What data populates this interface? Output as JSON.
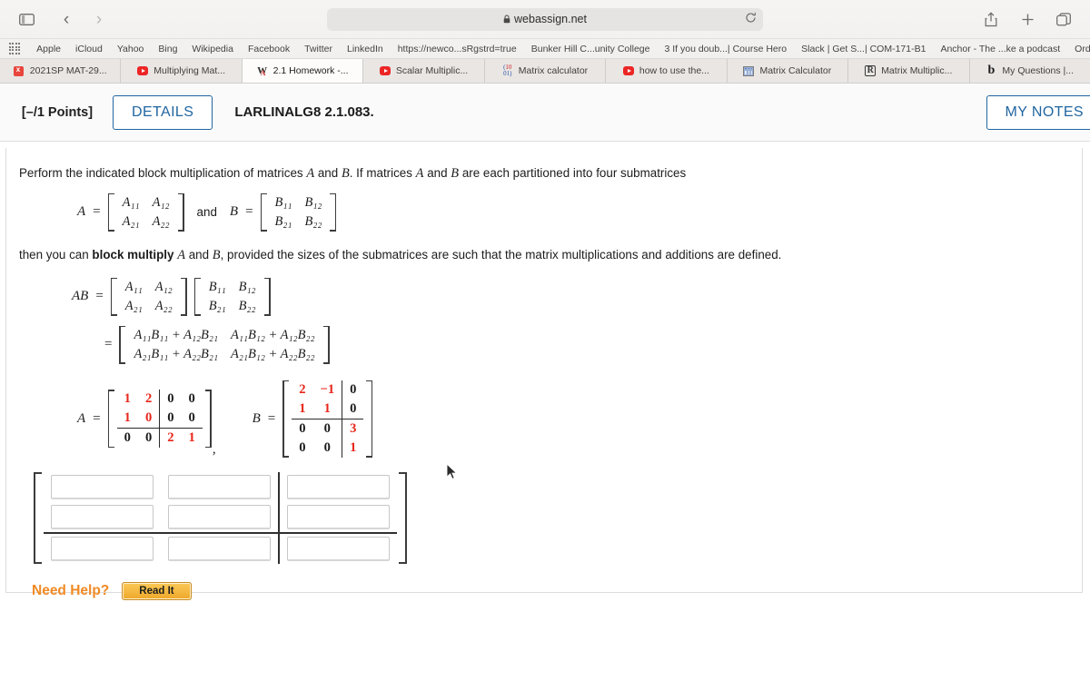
{
  "browser": {
    "url": "webassign.net",
    "lock_icon": "lock-icon",
    "sidebar_icon": "sidebar-icon",
    "back_icon": "chevron-left-icon",
    "forward_icon": "chevron-right-icon",
    "extension_icons": [
      "honey-extension-icon",
      "shield-extension-icon"
    ],
    "reload_icon": "reload-icon",
    "share_icon": "share-icon",
    "new_tab_icon": "plus-icon",
    "tab_overview_icon": "tab-overview-icon",
    "bookmarks": [
      "Apple",
      "iCloud",
      "Yahoo",
      "Bing",
      "Wikipedia",
      "Facebook",
      "Twitter",
      "LinkedIn",
      "https://newco...sRgstrd=true",
      "Bunker Hill C...unity College",
      "3 If you doub...| Course Hero",
      "Slack | Get S...| COM-171-B1",
      "Anchor - The ...ke a podcast",
      "Order received"
    ],
    "bookmarks_overflow": "»",
    "tabs": [
      {
        "label": "2021SP MAT-29...",
        "icon": "excel-icon",
        "active": false
      },
      {
        "label": "Multiplying Mat...",
        "icon": "youtube-icon",
        "active": false
      },
      {
        "label": "2.1 Homework -...",
        "icon": "webassign-icon",
        "active": true
      },
      {
        "label": "Scalar Multiplic...",
        "icon": "youtube-icon",
        "active": false
      },
      {
        "label": "Matrix calculator",
        "icon": "matrix-calc-icon",
        "active": false
      },
      {
        "label": "how to use the...",
        "icon": "youtube-icon",
        "active": false
      },
      {
        "label": "Matrix Calculator",
        "icon": "spreadsheet-icon",
        "active": false
      },
      {
        "label": "Matrix Multiplic...",
        "icon": "rstudio-icon",
        "active": false
      },
      {
        "label": "My Questions |...",
        "icon": "brainly-icon",
        "active": false
      }
    ]
  },
  "question": {
    "points": "[–/1 Points]",
    "details_label": "DETAILS",
    "title": "LARLINALG8 2.1.083.",
    "my_notes_label": "MY NOTES",
    "intro_part1": "Perform the indicated block multiplication of matrices",
    "intro_a": "A",
    "intro_and": "and",
    "intro_b": "B",
    "intro_part2": ". If matrices",
    "intro_part3": "are each partitioned into four submatrices",
    "then_text_1": "then you can",
    "then_bold": "block multiply",
    "then_text_2": "and",
    "then_text_3": ", provided the sizes of the submatrices are such that the matrix multiplications and additions are defined.",
    "label_A": "A",
    "label_B": "B",
    "label_AB": "AB",
    "label_eq": "=",
    "label_and": "and",
    "comma": ",",
    "symbolic_A": [
      [
        "A₁₁",
        "A₁₂"
      ],
      [
        "A₂₁",
        "A₂₂"
      ]
    ],
    "symbolic_B": [
      [
        "B₁₁",
        "B₁₂"
      ],
      [
        "B₂₁",
        "B₂₂"
      ]
    ],
    "product_expansion": [
      [
        "A₁₁B₁₁ + A₁₂B₂₁",
        "A₁₁B₁₂ + A₁₂B₂₂"
      ],
      [
        "A₂₁B₁₁ + A₂₂B₂₁",
        "A₂₁B₁₂ + A₂₂B₂₂"
      ]
    ],
    "need_help_label": "Need Help?",
    "read_it_label": "Read It"
  },
  "matrix_A": {
    "rows": 3,
    "cols": 4,
    "partition_after_row": 2,
    "partition_after_col": 2,
    "highlight_color": "#e8261c",
    "cells": [
      [
        {
          "v": "1",
          "red": true
        },
        {
          "v": "2",
          "red": true
        },
        {
          "v": "0",
          "red": false
        },
        {
          "v": "0",
          "red": false
        }
      ],
      [
        {
          "v": "1",
          "red": true
        },
        {
          "v": "0",
          "red": true
        },
        {
          "v": "0",
          "red": false
        },
        {
          "v": "0",
          "red": false
        }
      ],
      [
        {
          "v": "0",
          "red": false
        },
        {
          "v": "0",
          "red": false
        },
        {
          "v": "2",
          "red": true
        },
        {
          "v": "1",
          "red": true
        }
      ]
    ]
  },
  "matrix_B": {
    "rows": 4,
    "cols": 3,
    "partition_after_row": 2,
    "partition_after_col": 2,
    "highlight_color": "#e8261c",
    "cells": [
      [
        {
          "v": "2",
          "red": true
        },
        {
          "v": "−1",
          "red": true
        },
        {
          "v": "0",
          "red": false
        }
      ],
      [
        {
          "v": "1",
          "red": true
        },
        {
          "v": "1",
          "red": true
        },
        {
          "v": "0",
          "red": false
        }
      ],
      [
        {
          "v": "0",
          "red": false
        },
        {
          "v": "0",
          "red": false
        },
        {
          "v": "3",
          "red": true
        }
      ],
      [
        {
          "v": "0",
          "red": false
        },
        {
          "v": "0",
          "red": false
        },
        {
          "v": "1",
          "red": true
        }
      ]
    ]
  },
  "answer_grid": {
    "rows": 3,
    "cols": 3,
    "partition_after_row": 2,
    "partition_after_col": 2,
    "values": [
      [
        "",
        "",
        ""
      ],
      [
        "",
        "",
        ""
      ],
      [
        "",
        "",
        ""
      ]
    ]
  }
}
